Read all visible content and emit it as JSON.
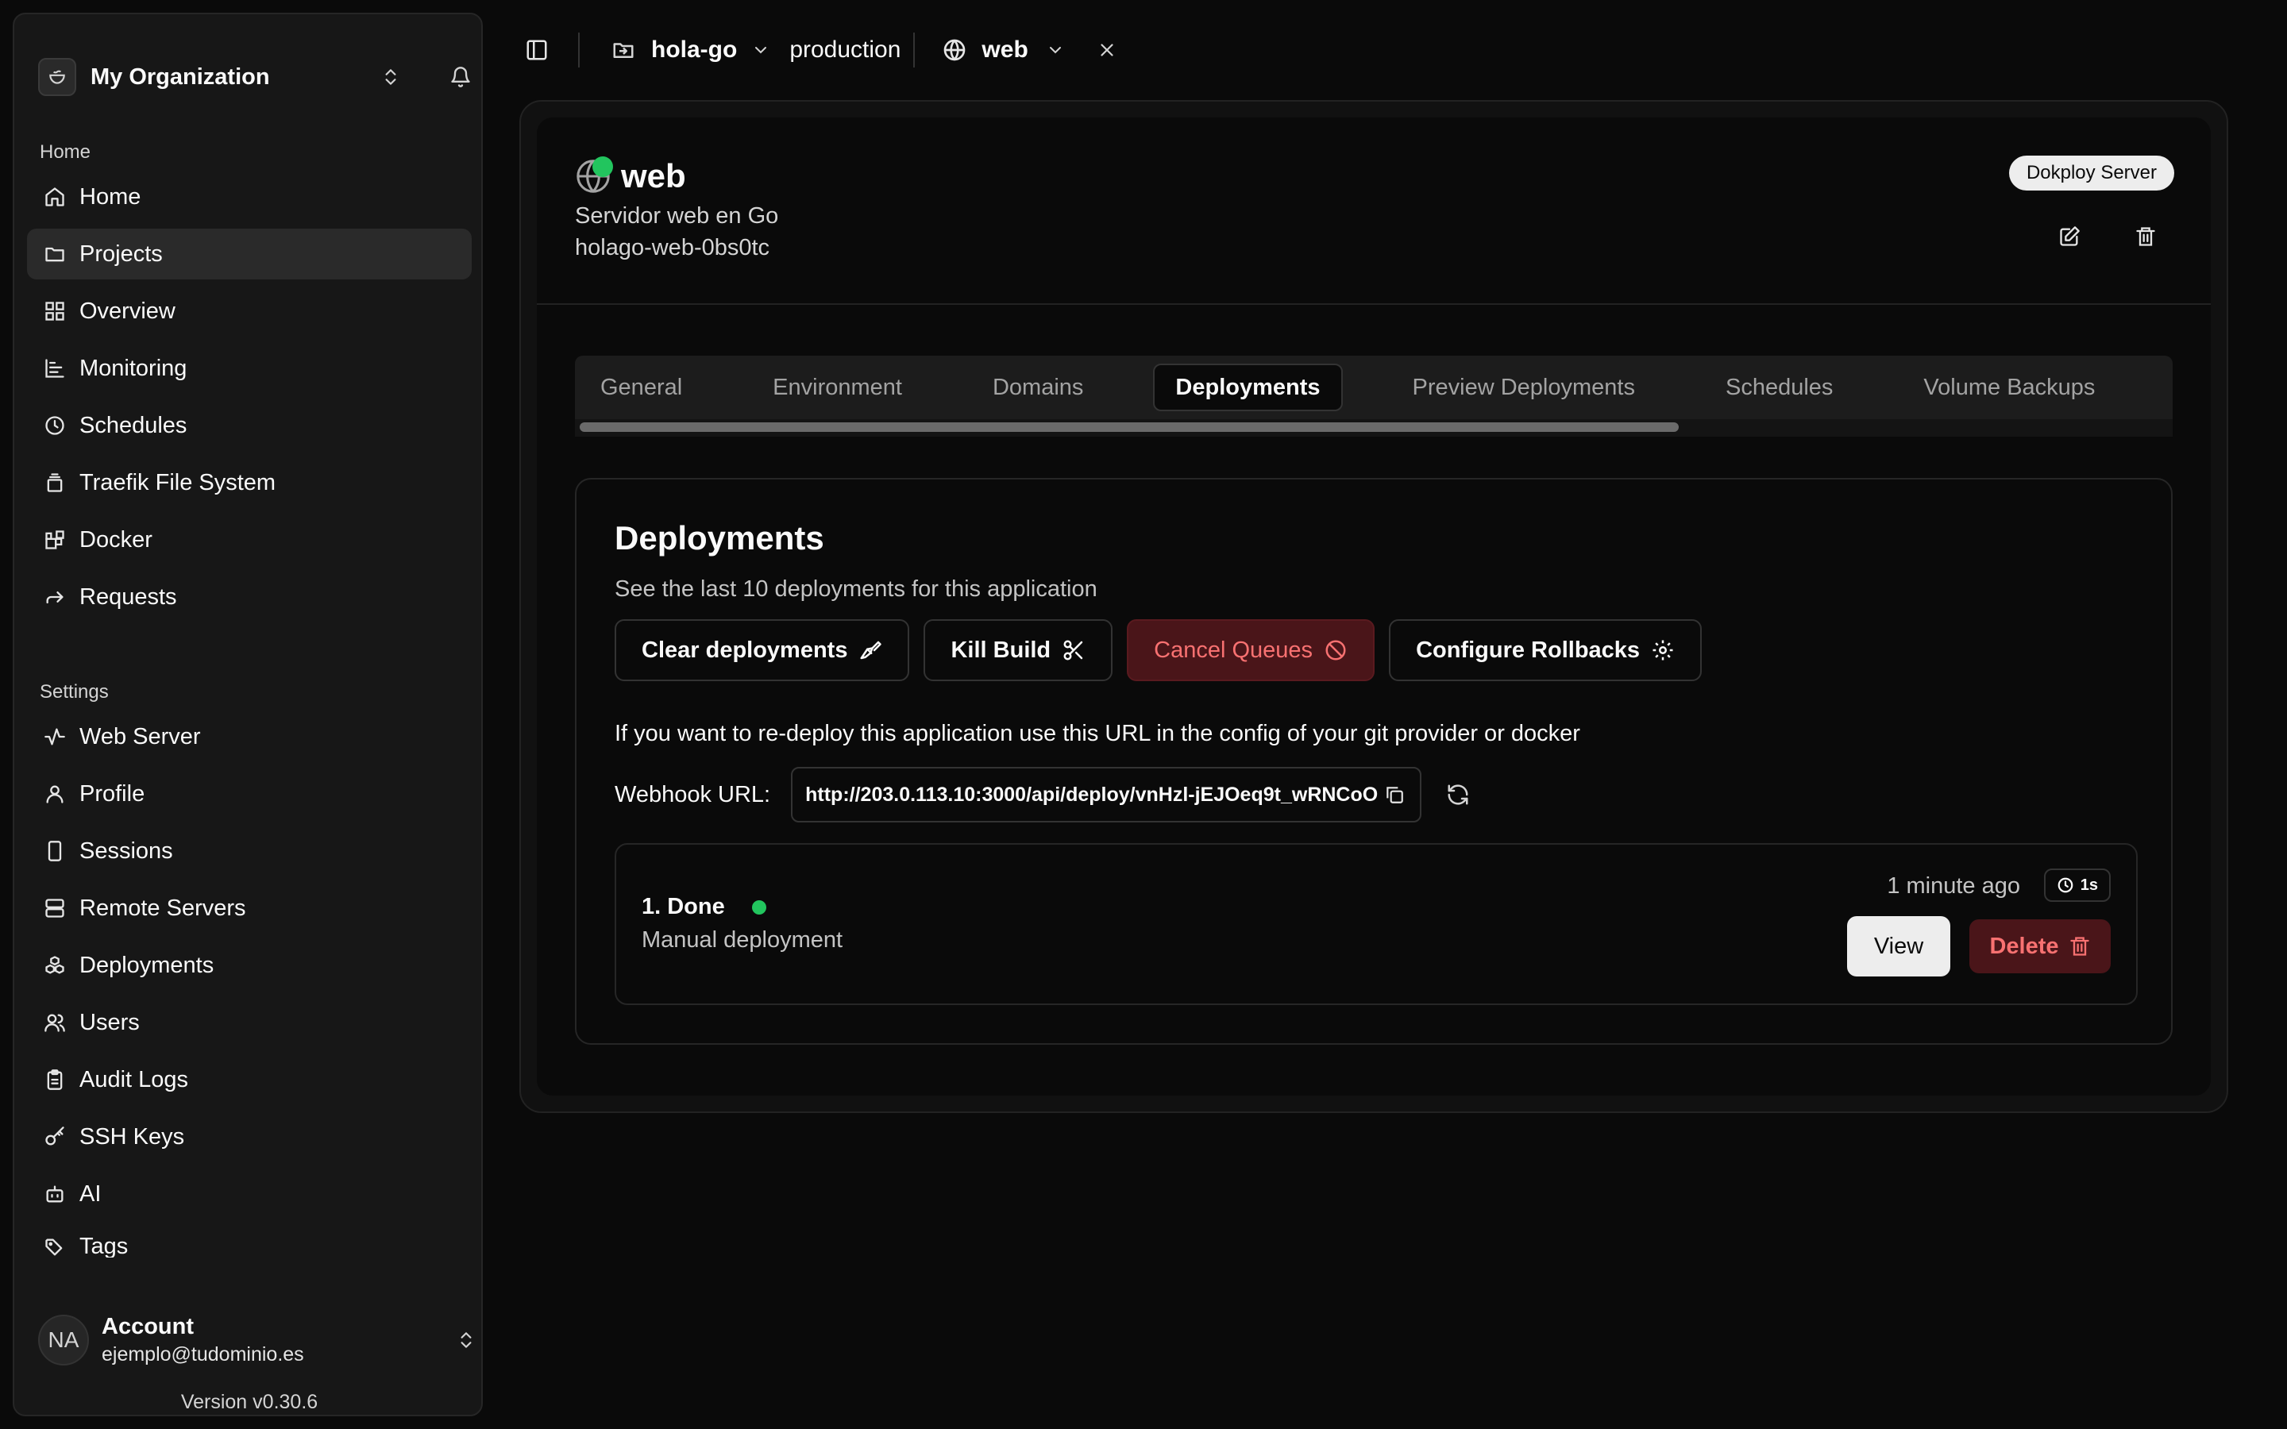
{
  "sidebar": {
    "org_name": "My Organization",
    "home_section": "Home",
    "settings_section": "Settings",
    "home_items": [
      {
        "label": "Home",
        "icon": "home-icon"
      },
      {
        "label": "Projects",
        "icon": "folder-icon",
        "active": true
      },
      {
        "label": "Overview",
        "icon": "grid-icon"
      },
      {
        "label": "Monitoring",
        "icon": "chart-icon"
      },
      {
        "label": "Schedules",
        "icon": "clock-icon"
      },
      {
        "label": "Traefik File System",
        "icon": "layers-icon"
      },
      {
        "label": "Docker",
        "icon": "blocks-icon"
      },
      {
        "label": "Requests",
        "icon": "forward-icon"
      }
    ],
    "settings_items": [
      {
        "label": "Web Server",
        "icon": "activity-icon"
      },
      {
        "label": "Profile",
        "icon": "user-icon"
      },
      {
        "label": "Sessions",
        "icon": "phone-icon"
      },
      {
        "label": "Remote Servers",
        "icon": "server-icon"
      },
      {
        "label": "Deployments",
        "icon": "boxes-icon"
      },
      {
        "label": "Users",
        "icon": "users-icon"
      },
      {
        "label": "Audit Logs",
        "icon": "clipboard-icon"
      },
      {
        "label": "SSH Keys",
        "icon": "key-icon"
      },
      {
        "label": "AI",
        "icon": "bot-icon"
      },
      {
        "label": "Tags",
        "icon": "tags-icon"
      }
    ],
    "account": {
      "initials": "NA",
      "name": "Account",
      "email": "ejemplo@tudominio.es"
    },
    "version": "Version v0.30.6"
  },
  "topbar": {
    "project": "hola-go",
    "environment": "production",
    "service": "web"
  },
  "app": {
    "name": "web",
    "description": "Servidor web en Go",
    "app_id": "holago-web-0bs0tc",
    "server_badge": "Dokploy Server",
    "status_color": "#22c55e"
  },
  "tabs": [
    {
      "label": "General"
    },
    {
      "label": "Environment"
    },
    {
      "label": "Domains"
    },
    {
      "label": "Deployments",
      "active": true
    },
    {
      "label": "Preview Deployments"
    },
    {
      "label": "Schedules"
    },
    {
      "label": "Volume Backups"
    }
  ],
  "deployments": {
    "title": "Deployments",
    "subtitle": "See the last 10 deployments for this application",
    "actions": {
      "clear": "Clear deployments",
      "kill": "Kill Build",
      "cancel": "Cancel Queues",
      "rollbacks": "Configure Rollbacks"
    },
    "hint": "If you want to re-deploy this application use this URL in the config of your git provider or docker",
    "webhook_label": "Webhook URL:",
    "webhook_url": "http://203.0.113.10:3000/api/deploy/vnHzl-jEJOeq9t_wRNCoO",
    "list": [
      {
        "status": "1. Done",
        "type": "Manual deployment",
        "time": "1 minute ago",
        "duration": "1s",
        "view_label": "View",
        "delete_label": "Delete"
      }
    ]
  },
  "colors": {
    "accent_danger": "#f87171",
    "danger_bg": "#4a1519",
    "success": "#22c55e"
  }
}
